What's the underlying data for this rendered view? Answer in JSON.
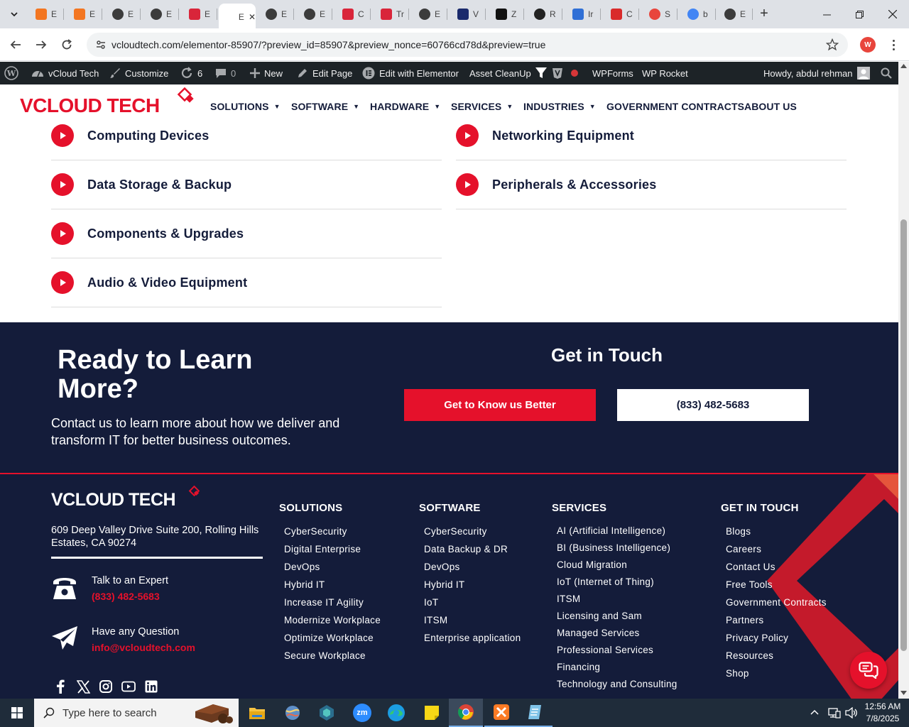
{
  "browser": {
    "tabs": [
      {
        "letter": "E",
        "icon": "xampp-icon",
        "color": "#f37621"
      },
      {
        "letter": "E",
        "icon": "xampp-icon",
        "color": "#f37621"
      },
      {
        "letter": "E",
        "icon": "wordpress-icon",
        "color": "#3c3c3c"
      },
      {
        "letter": "E",
        "icon": "wordpress-icon",
        "color": "#3c3c3c"
      },
      {
        "letter": "E",
        "icon": "elementor-diamond-icon",
        "color": "#d9253a"
      },
      {
        "letter": "E",
        "icon": "active-tab-icon",
        "color": "#ffffff",
        "active": true
      },
      {
        "letter": "E",
        "icon": "wordpress-icon",
        "color": "#3c3c3c"
      },
      {
        "letter": "E",
        "icon": "wordpress-icon",
        "color": "#3c3c3c"
      },
      {
        "letter": "C",
        "icon": "elementor-diamond-icon",
        "color": "#d9253a"
      },
      {
        "letter": "Tr",
        "icon": "elementor-diamond-icon",
        "color": "#d9253a"
      },
      {
        "letter": "E",
        "icon": "wordpress-icon",
        "color": "#3c3c3c"
      },
      {
        "letter": "V",
        "icon": "v-icon",
        "color": "#1a2a6c"
      },
      {
        "letter": "Z",
        "icon": "z-icon",
        "color": "#111111"
      },
      {
        "letter": "R",
        "icon": "r-icon",
        "color": "#222222"
      },
      {
        "letter": "Ir",
        "icon": "bird-icon",
        "color": "#2f6fd6"
      },
      {
        "letter": "C",
        "icon": "signature-icon",
        "color": "#d92b2b"
      },
      {
        "letter": "S",
        "icon": "s-icon",
        "color": "#e8453c"
      },
      {
        "letter": "b",
        "icon": "google-icon",
        "color": "#4285f4"
      },
      {
        "letter": "E",
        "icon": "wordpress-icon",
        "color": "#3c3c3c"
      }
    ],
    "new_tab_label": "+",
    "url": "vcloudtech.com/elementor-85907/?preview_id=85907&preview_nonce=60766cd78d&preview=true",
    "profile_letter": "W"
  },
  "adminbar": {
    "site_name": "vCloud Tech",
    "customize": "Customize",
    "updates": "6",
    "comments": "0",
    "new": "New",
    "edit_page": "Edit Page",
    "edit_elementor": "Edit with Elementor",
    "asset_cleanup": "Asset CleanUp",
    "wpforms": "WPForms",
    "wp_rocket": "WP Rocket",
    "howdy": "Howdy, abdul rehman"
  },
  "header": {
    "logo": "VCLOUD TECH",
    "menu": [
      "SOLUTIONS",
      "SOFTWARE",
      "HARDWARE",
      "SERVICES",
      "INDUSTRIES",
      "GOVERNMENT CONTRACTS",
      "ABOUT US"
    ]
  },
  "categories": {
    "left": [
      "Computing Devices",
      "Data Storage & Backup",
      "Components & Upgrades",
      "Audio & Video Equipment"
    ],
    "right": [
      "Networking Equipment",
      "Peripherals & Accessories"
    ]
  },
  "cta": {
    "title": "Ready to Learn More?",
    "description": "Contact us to learn more about how we deliver and transform IT for better business outcomes.",
    "get_in_touch": "Get in Touch",
    "primary_button": "Get to Know us Better",
    "phone_button": "(833) 482-5683"
  },
  "footer": {
    "logo": "VCLOUD TECH",
    "address": "609 Deep Valley Drive Suite 200, Rolling Hills Estates, CA 90274",
    "talk_label": "Talk to an Expert",
    "talk_phone": "(833) 482-5683",
    "question_label": "Have any Question",
    "question_email": "info@vcloudtech.com",
    "solutions": {
      "title": "SOLUTIONS",
      "links": [
        "CyberSecurity",
        "Digital Enterprise",
        "DevOps",
        "Hybrid IT",
        "Increase IT Agility",
        "Modernize Workplace",
        "Optimize Workplace",
        "Secure Workplace"
      ]
    },
    "software": {
      "title": "SOFTWARE",
      "links": [
        "CyberSecurity",
        "Data Backup & DR",
        "DevOps",
        "Hybrid IT",
        "IoT",
        "ITSM",
        "Enterprise application"
      ]
    },
    "services": {
      "title": "SERVICES",
      "links": [
        "AI (Artificial Intelligence)",
        "BI (Business Intelligence)",
        "Cloud Migration",
        "IoT (Internet of Thing)",
        "ITSM",
        "Licensing and Sam",
        "Managed Services",
        "Professional Services",
        "Financing",
        "Technology and Consulting"
      ]
    },
    "contact": {
      "title": "GET IN TOUCH",
      "links": [
        "Blogs",
        "Careers",
        "Contact Us",
        "Free Tools",
        "Government Contracts",
        "Partners",
        "Privacy Policy",
        "Resources",
        "Shop"
      ]
    }
  },
  "taskbar": {
    "search_placeholder": "Type here to search",
    "time": "12:56 AM",
    "date": "7/8/2025",
    "zoom_label": "zm"
  },
  "colors": {
    "navy": "#141c3a",
    "accent_red": "#e5112b",
    "admin_bar": "#1d2327"
  }
}
